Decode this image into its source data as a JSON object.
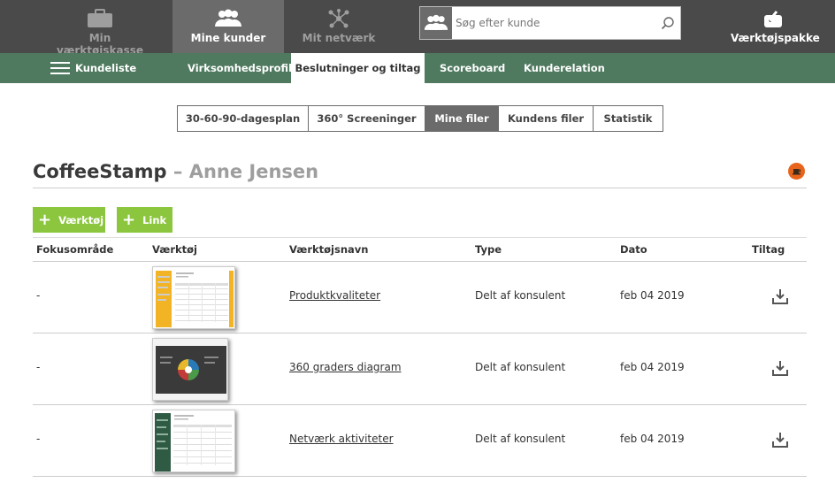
{
  "topnav": {
    "toolbox": "Min værktøjskasse",
    "my_clients": "Mine kunder",
    "network": "Mit netværk",
    "toolpack": "Værktøjspakke"
  },
  "search": {
    "placeholder": "Søg efter kunde"
  },
  "subnav": {
    "client_list": "Kundeliste",
    "items": [
      "Virksomhedsprofil",
      "Beslutninger og tiltag",
      "Scoreboard",
      "Kunderelation"
    ],
    "active": "Beslutninger og tiltag"
  },
  "tabs": {
    "items": [
      "30-60-90-dagesplan",
      "360° Screeninger",
      "Mine filer",
      "Kundens filer",
      "Statistik"
    ],
    "active": "Mine filer"
  },
  "page": {
    "company": "CoffeeStamp",
    "separator": " – ",
    "contact": "Anne Jensen"
  },
  "buttons": {
    "tool": "Værktøj",
    "link": "Link"
  },
  "table": {
    "headers": [
      "Fokusområde",
      "Værktøj",
      "Værktøjsnavn",
      "Type",
      "Dato",
      "Tiltag"
    ],
    "rows": [
      {
        "focus": "-",
        "name": "Produktkvaliteter",
        "type": "Delt af konsulent",
        "date": "feb 04 2019"
      },
      {
        "focus": "-",
        "name": "360 graders diagram",
        "type": "Delt af konsulent",
        "date": "feb 04 2019"
      },
      {
        "focus": "-",
        "name": "Netværk aktiviteter",
        "type": "Delt af konsulent",
        "date": "feb 04 2019"
      }
    ]
  },
  "colors": {
    "topbar": "#4a4a4a",
    "subbar": "#4f7a5f",
    "accent_green": "#8cc63f",
    "orange": "#e8641c"
  }
}
